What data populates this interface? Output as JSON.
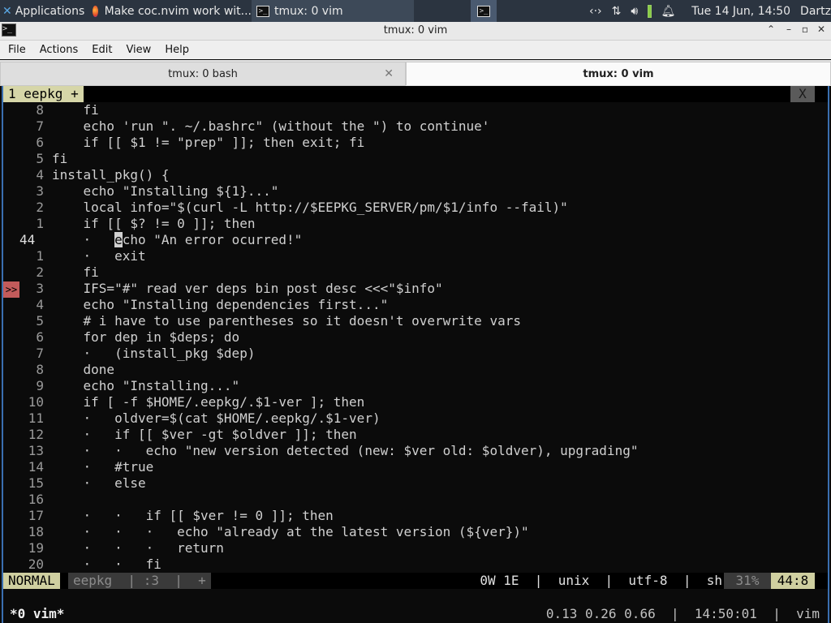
{
  "panel": {
    "apps_label": "Applications",
    "task1_label": "Make coc.nvim work wit...",
    "task2_label": "tmux: 0 vim",
    "tray_icons": [
      "network-icon",
      "transfer-icon",
      "volume-icon",
      "battery-icon",
      "bell-icon"
    ],
    "datetime": "Tue 14 Jun, 14:50",
    "user": "Dartz"
  },
  "window": {
    "title": "tmux: 0 vim"
  },
  "menu": {
    "items": [
      "File",
      "Actions",
      "Edit",
      "View",
      "Help"
    ]
  },
  "tabs": {
    "tab1": "tmux: 0 bash",
    "tab2": "tmux: 0 vim"
  },
  "vim": {
    "buffer_label": "1  eepkg  +",
    "buffer_close": "X",
    "lines": [
      {
        "n": "8",
        "t": "    fi"
      },
      {
        "n": "7",
        "t": "    echo 'run \". ~/.bashrc\" (without the \") to continue'"
      },
      {
        "n": "6",
        "t": "    if [[ $1 != \"prep\" ]]; then exit; fi"
      },
      {
        "n": "5",
        "t": "fi"
      },
      {
        "n": "4",
        "t": "install_pkg() {"
      },
      {
        "n": "3",
        "t": "    echo \"Installing ${1}...\""
      },
      {
        "n": "2",
        "t": "    local info=\"$(curl -L http://$EEPKG_SERVER/pm/$1/info --fail)\""
      },
      {
        "n": "1",
        "t": "    if [[ $? != 0 ]]; then"
      },
      {
        "n": "44",
        "t": "    ·   echo \"An error ocurred!\"",
        "cur": true
      },
      {
        "n": "1",
        "t": "    ·   exit"
      },
      {
        "n": "2",
        "t": "    fi"
      },
      {
        "n": "3",
        "t": "    IFS=\"#\" read ver deps bin post desc <<<\"$info\"",
        "sign": ">>"
      },
      {
        "n": "4",
        "t": "    echo \"Installing dependencies first...\""
      },
      {
        "n": "5",
        "t": "    # i have to use parentheses so it doesn't overwrite vars"
      },
      {
        "n": "6",
        "t": "    for dep in $deps; do"
      },
      {
        "n": "7",
        "t": "    ·   (install_pkg $dep)"
      },
      {
        "n": "8",
        "t": "    done"
      },
      {
        "n": "9",
        "t": "    echo \"Installing...\""
      },
      {
        "n": "10",
        "t": "    if [ -f $HOME/.eepkg/.$1-ver ]; then"
      },
      {
        "n": "11",
        "t": "    ·   oldver=$(cat $HOME/.eepkg/.$1-ver)"
      },
      {
        "n": "12",
        "t": "    ·   if [[ $ver -gt $oldver ]]; then"
      },
      {
        "n": "13",
        "t": "    ·   ·   echo \"new version detected (new: $ver old: $oldver), upgrading\""
      },
      {
        "n": "14",
        "t": "    ·   #true"
      },
      {
        "n": "15",
        "t": "    ·   else"
      },
      {
        "n": "16",
        "t": ""
      },
      {
        "n": "17",
        "t": "    ·   ·   if [[ $ver != 0 ]]; then"
      },
      {
        "n": "18",
        "t": "    ·   ·   ·   echo \"already at the latest version (${ver})\""
      },
      {
        "n": "19",
        "t": "    ·   ·   ·   return"
      },
      {
        "n": "20",
        "t": "    ·   ·   fi"
      }
    ],
    "status": {
      "mode": "NORMAL",
      "file": "eepkg  | :3  |  +",
      "right": "0W 1E  |  unix  |  utf-8  |  sh",
      "percent": "31%",
      "position": "44:8"
    }
  },
  "tmux": {
    "window": "*0 vim*",
    "right": "0.13 0.26 0.66  |  14:50:01  |  vim"
  }
}
